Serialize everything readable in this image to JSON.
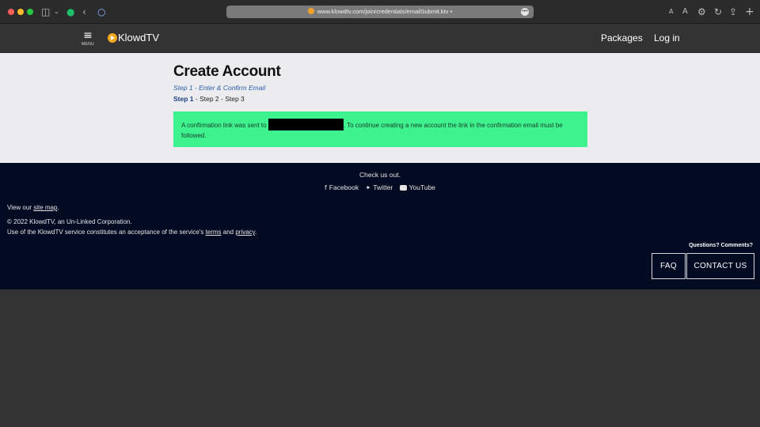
{
  "browser": {
    "url": "www.klowdtv.com/join/credentials/emailSubmit.ktv",
    "traffic_lights": [
      "#ff5f57",
      "#febc2e",
      "#28c840"
    ],
    "toolbar_icons": [
      "sidebar-icon",
      "chevron-down-icon",
      "grammarly-icon",
      "back-icon",
      "colorwheel-icon",
      "text-smaller-icon",
      "text-larger-icon",
      "gear-icon",
      "reload-icon",
      "share-icon",
      "new-tab-icon"
    ]
  },
  "header": {
    "menu_label": "MENU",
    "logo_text": "KlowdTV",
    "nav": {
      "packages": "Packages",
      "login": "Log in"
    }
  },
  "main": {
    "title": "Create Account",
    "step_subtitle": "Step 1 - Enter & Confirm Email",
    "steps": {
      "current": "Step 1",
      "rest": " - Step 2 - Step 3"
    },
    "alert": {
      "text_before": "A confirmation link was sent to ",
      "text_after": ". To continue creating a new account the link in the confirmation email must be followed.",
      "background": "#3ef38e"
    }
  },
  "footer": {
    "check_us_out": "Check us out.",
    "social": {
      "facebook": "Facebook",
      "twitter": "Twitter",
      "youtube": "YouTube"
    },
    "sitemap_prefix": "View our ",
    "sitemap_link": "site map",
    "sitemap_suffix": ".",
    "copyright": "© 2022 KlowdTV, an Un-Linked Corporation.",
    "terms_prefix": "Use of the KlowdTV service constitutes an acceptance of the service's ",
    "terms_link": "terms",
    "terms_and": " and ",
    "privacy_link": "privacy",
    "terms_suffix": ".",
    "questions": "Questions? Comments?",
    "faq_label": "FAQ",
    "contact_label": "CONTACT US",
    "background": "#020b22"
  }
}
